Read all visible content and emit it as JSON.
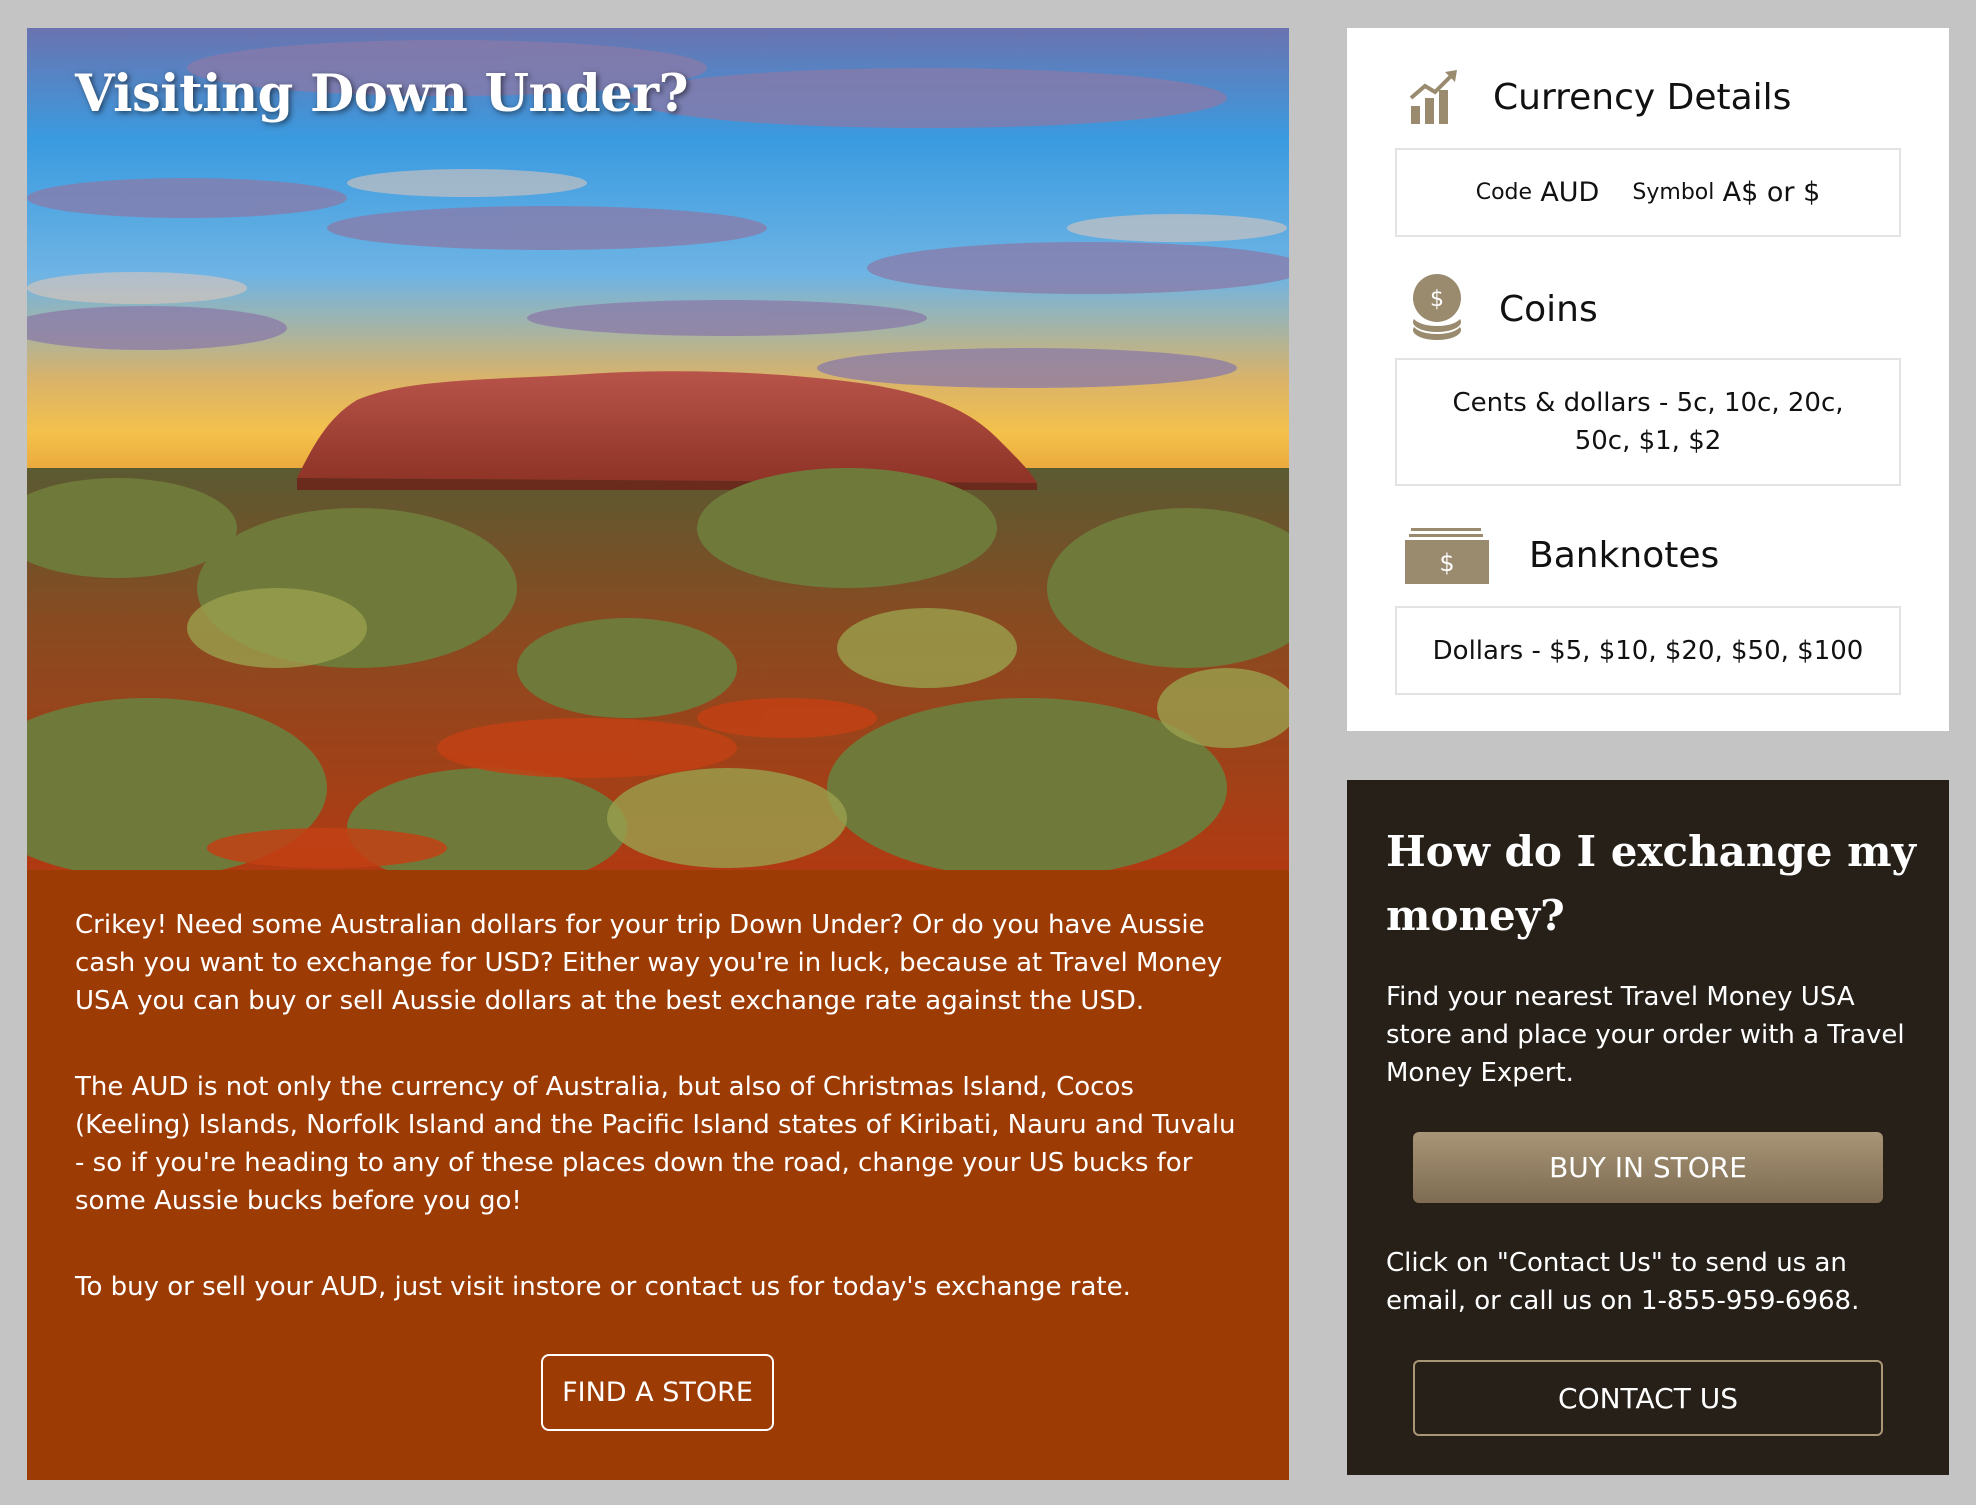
{
  "hero": {
    "title": "Visiting Down Under?",
    "image_description": "Uluru"
  },
  "intro": {
    "paragraphs": [
      "Crikey! Need some Australian dollars for your trip Down Under? Or do you have Aussie cash you want to exchange for USD? Either way you're in luck, because at Travel Money USA you can buy or sell Aussie dollars at the best exchange rate against the USD.",
      "The AUD is not only the currency of Australia, but also of Christmas Island, Cocos (Keeling) Islands, Norfolk Island and the Pacific Island states of Kiribati, Nauru and Tuvalu - so if you're heading to any of these places down the road, change your US bucks for some Aussie bucks before you go!",
      "To buy or sell your AUD, just visit instore or contact us for today's exchange rate."
    ],
    "find_store_label": "FIND A STORE"
  },
  "details": {
    "currency": {
      "heading": "Currency Details",
      "code_label": "Code",
      "code_value": "AUD",
      "symbol_label": "Symbol",
      "symbol_value": "A$ or $"
    },
    "coins": {
      "heading": "Coins",
      "text": "Cents & dollars - 5c, 10c, 20c, 50c, $1, $2"
    },
    "banknotes": {
      "heading": "Banknotes",
      "text": "Dollars - $5, $10, $20, $50, $100"
    }
  },
  "exchange": {
    "title": "How do I exchange my money?",
    "text1": "Find your nearest Travel Money USA store and place your order with a Travel Money Expert.",
    "buy_label": "BUY IN STORE",
    "text2": "Click on \"Contact Us\" to send us an email, or call us on 1-855-959-6968.",
    "contact_label": "CONTACT US"
  },
  "colors": {
    "page_bg": "#c4c4c4",
    "intro_bg": "#9d3b04",
    "exchange_bg": "#262019",
    "icon_tan": "#9a8b6f",
    "button_gold": "#8f7d60"
  }
}
